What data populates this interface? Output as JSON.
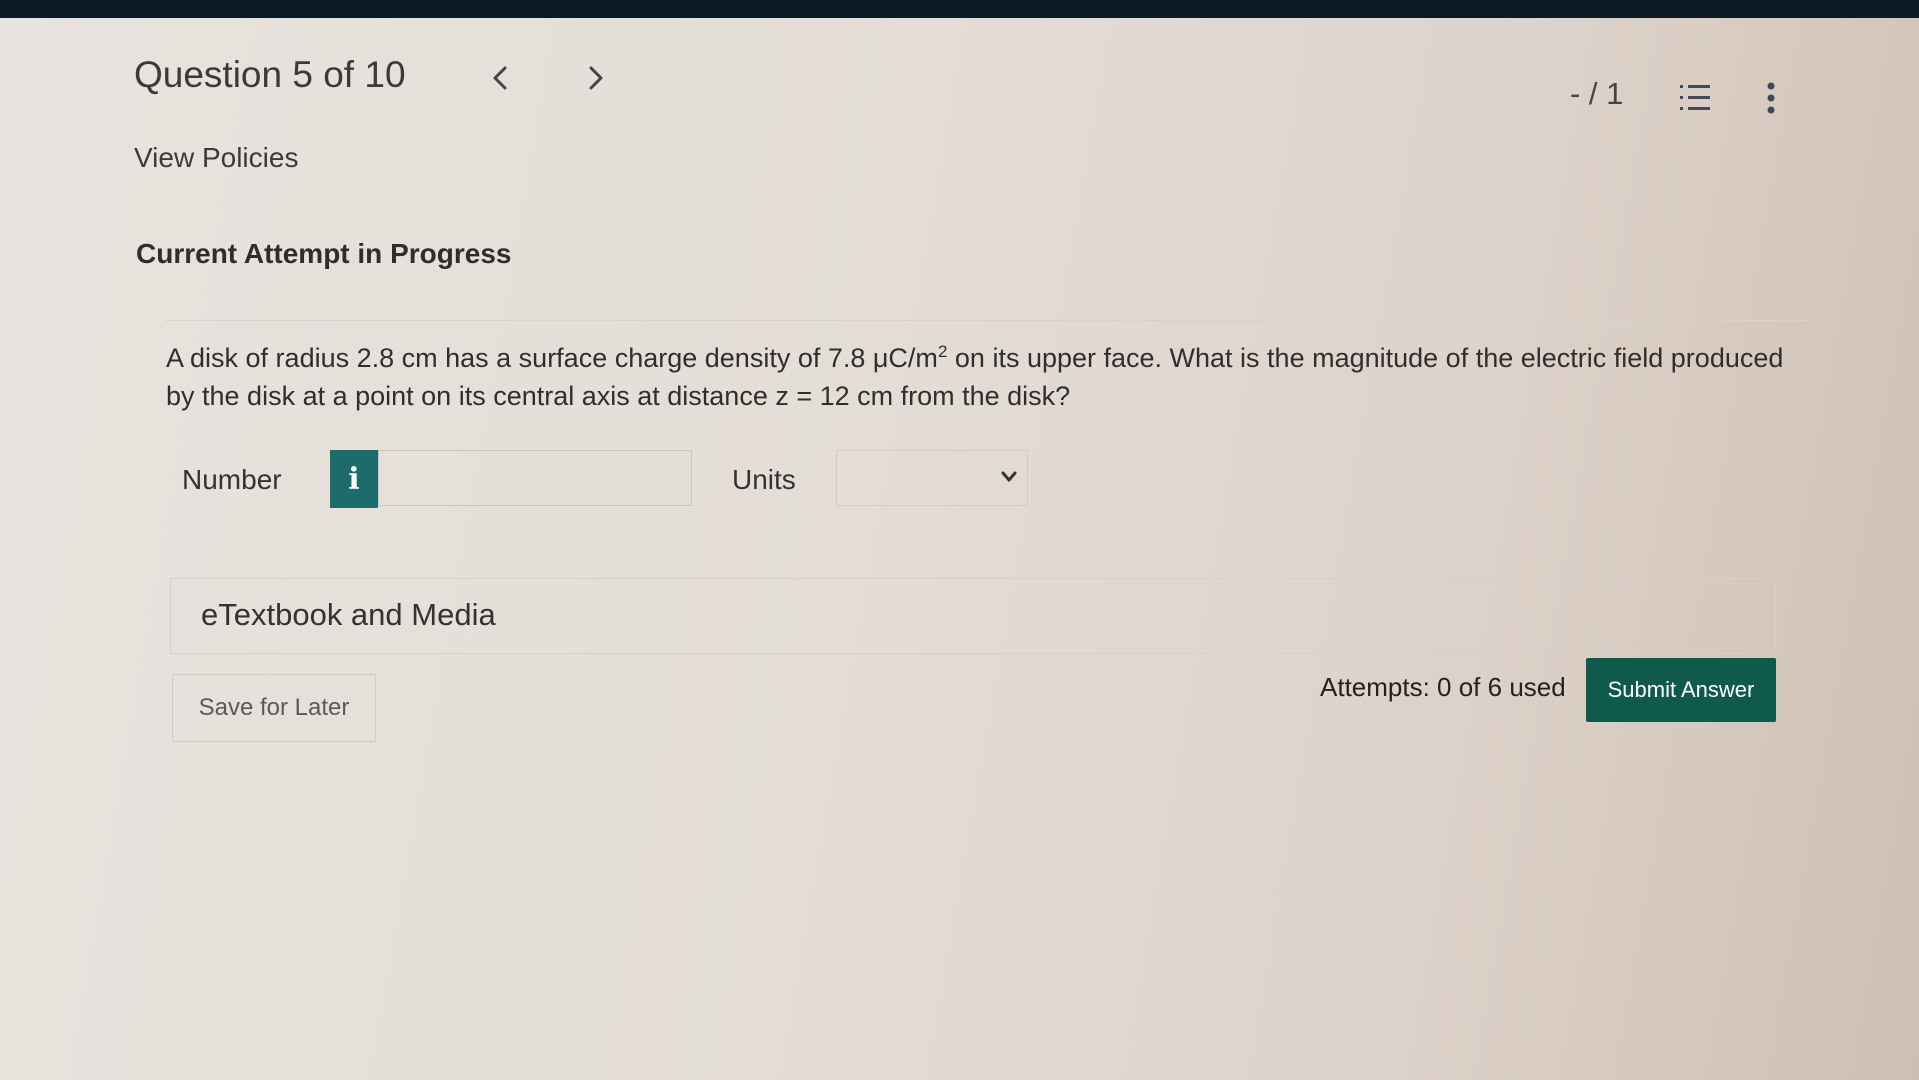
{
  "header": {
    "question_title": "Question 5 of 10",
    "score": "- / 1",
    "policies_link": "View Policies"
  },
  "icons": {
    "previous": "chevron-left-icon",
    "next": "chevron-right-icon",
    "list": "numbered-list-icon",
    "more": "vertical-dots-icon",
    "info": "info-icon",
    "select_arrow": "chevron-down-icon"
  },
  "attempt": {
    "heading": "Current Attempt in Progress"
  },
  "question": {
    "text_part1": "A disk of radius 2.8 cm has a surface charge density of 7.8 μC/m",
    "superscript": "2",
    "text_part2": " on its upper face. What is the magnitude of the electric field produced",
    "text_line2": "by the disk at a point on its central axis at distance z = 12 cm from the disk?"
  },
  "answer": {
    "number_label": "Number",
    "info_glyph": "i",
    "number_value": "",
    "units_label": "Units",
    "units_selected": ""
  },
  "media": {
    "label": "eTextbook and Media"
  },
  "footer": {
    "save_label": "Save for Later",
    "attempts_text": "Attempts: 0 of 6 used",
    "submit_label": "Submit Answer"
  },
  "colors": {
    "accent_teal": "#1d6b6a",
    "submit_green": "#0f5a4b",
    "top_strip": "#0d1a24"
  }
}
